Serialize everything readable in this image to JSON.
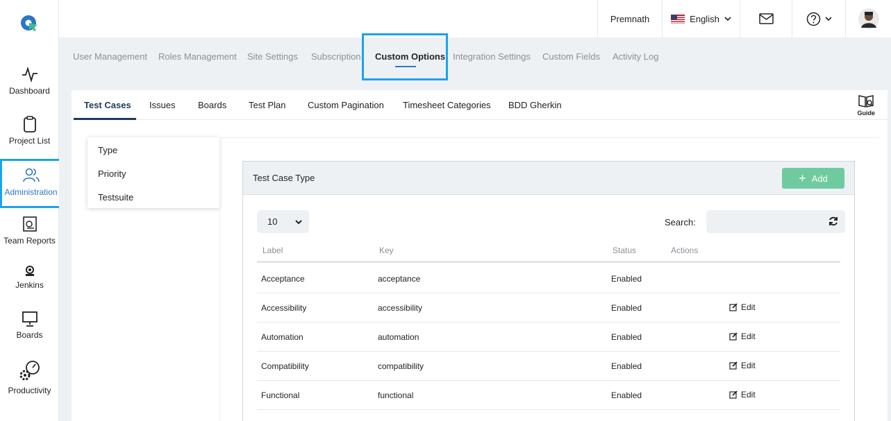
{
  "sidebar": {
    "items": [
      {
        "label": "Dashboard",
        "icon": "activity-icon"
      },
      {
        "label": "Project List",
        "icon": "clipboard-icon"
      },
      {
        "label": "Administration",
        "icon": "users-icon"
      },
      {
        "label": "Team Reports",
        "icon": "report-icon"
      },
      {
        "label": "Jenkins",
        "icon": "jenkins-icon"
      },
      {
        "label": "Boards",
        "icon": "presentation-board-icon"
      },
      {
        "label": "Productivity",
        "icon": "gauge-gear-icon"
      }
    ]
  },
  "topbar": {
    "user_name": "Premnath",
    "language": "English"
  },
  "admin_tabs": [
    "User Management",
    "Roles Management",
    "Site Settings",
    "Subscription",
    "Custom Options",
    "Integration Settings",
    "Custom Fields",
    "Activity Log"
  ],
  "sub_tabs": [
    "Test Cases",
    "Issues",
    "Boards",
    "Test Plan",
    "Custom Pagination",
    "Timesheet Categories",
    "BDD Gherkin"
  ],
  "guide_label": "Guide",
  "options_menu": [
    "Type",
    "Priority",
    "Testsuite"
  ],
  "panel": {
    "title": "Test Case Type",
    "add_label": "Add",
    "page_size": "10",
    "search_label": "Search:"
  },
  "table": {
    "headers": [
      "Label",
      "Key",
      "Status",
      "Actions"
    ],
    "rows": [
      {
        "label": "Acceptance",
        "key": "acceptance",
        "status": "Enabled",
        "action": ""
      },
      {
        "label": "Accessibility",
        "key": "accessibility",
        "status": "Enabled",
        "action": "Edit"
      },
      {
        "label": "Automation",
        "key": "automation",
        "status": "Enabled",
        "action": "Edit"
      },
      {
        "label": "Compatibility",
        "key": "compatibility",
        "status": "Enabled",
        "action": "Edit"
      },
      {
        "label": "Functional",
        "key": "functional",
        "status": "Enabled",
        "action": "Edit"
      }
    ]
  },
  "colors": {
    "highlight": "#1aa3f0",
    "add_button": "#6fcb9f",
    "active_tab": "#1f3a5a"
  }
}
